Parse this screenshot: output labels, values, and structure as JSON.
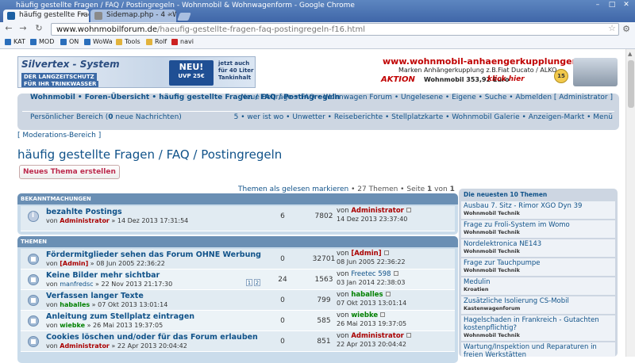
{
  "window": {
    "title": "häufig gestellte Fragen / FAQ / Postingregeln - Wohnmobil & Wohnwagenform - Google Chrome",
    "controls": [
      "–",
      "□",
      "✕"
    ]
  },
  "tabs": [
    {
      "label": "häufig gestellte Fragen",
      "active": true
    },
    {
      "label": "Sidemap.php - 4 - Wo",
      "active": false
    }
  ],
  "address": {
    "host": "www.wohnmobilforum.de",
    "path": "/haeufig-gestellte-fragen-faq-postingregeln-f16.html"
  },
  "nav_icons": {
    "back": "back-arrow-icon",
    "forward": "forward-arrow-icon",
    "reload": "reload-icon",
    "star": "bookmark-star-icon",
    "menu": "wrench-icon"
  },
  "bookmarks": [
    {
      "label": "KAT",
      "color": "#2a6ebb"
    },
    {
      "label": "MOD",
      "color": "#2a6ebb"
    },
    {
      "label": "ON",
      "color": "#2a6ebb"
    },
    {
      "label": "WoWa",
      "color": "#2a6ebb"
    },
    {
      "label": "Tools",
      "color": "#e2b33d"
    },
    {
      "label": "Rolf",
      "color": "#e2b33d"
    },
    {
      "label": "navi",
      "color": "#cc2222"
    }
  ],
  "banner_left": {
    "title": "Silvertex - System",
    "line1": "DER LANGZEITSCHUTZ",
    "line2": "FÜR IHR TRINKWASSER",
    "badge_top": "NEU!",
    "badge_sub": "UVP 25€",
    "side_text1": "jetzt auch",
    "side_text2": "für 40 Liter",
    "side_text3": "Tankinhalt"
  },
  "banner_right": {
    "url": "www.wohnmobil-anhaengerkupplungen.de",
    "line2": "Marken Anhängerkupplung z.B.Fiat Ducato / ALKO",
    "aktion": "AKTION",
    "price": "Wohnmobil 353,92 Euro",
    "cta": "klick hier",
    "badge": "15"
  },
  "navbar": {
    "breadcrumb": "Wohnmobil • Foren-Übersicht • häufig gestellte Fragen / FAQ / Postingregeln",
    "quick_links": "Neue Beiträge • FAQ • Wohnwagen Forum • Ungelesene • Eigene • Suche • Abmelden [ Administrator ]",
    "personal_prefix": "Persönlicher Bereich (",
    "personal_count": "0",
    "personal_suffix": " neue Nachrichten)",
    "links2": "5 • wer ist wo • Unwetter • Reiseberichte • Stellplatzkarte • Wohnmobil Galerie • Anzeigen-Markt • Menü"
  },
  "moderation": "[ Moderations-Bereich ]",
  "page_title": "häufig gestellte Fragen / FAQ / Postingregeln",
  "new_topic_button": "Neues Thema erstellen",
  "pagination": {
    "mark_read": "Themen als gelesen markieren",
    "count": " • 27 Themen • Seite ",
    "current": "1",
    "of": " von ",
    "total": "1"
  },
  "announcements": {
    "header": "BEKANNTMACHUNGEN",
    "topics": [
      {
        "title": "bezahlte Postings",
        "by": "von ",
        "author": "Administrator",
        "date": " » 14 Dez 2013 17:31:54",
        "replies": "6",
        "views": "7802",
        "last_by": "von ",
        "last_author": "Administrator",
        "last_date": "14 Dez 2013 23:37:40"
      }
    ]
  },
  "topics": {
    "header": "THEMEN",
    "items": [
      {
        "title": "Fördermitglieder sehen das Forum OHNE Werbung",
        "by": "von ",
        "author": "[Admin]",
        "date": " » 08 Jun 2005 22:36:22",
        "replies": "0",
        "views": "32701",
        "last_by": "von ",
        "last_author": "[Admin]",
        "last_date": "08 Jun 2005 22:36:22",
        "author_color": "red",
        "pages": []
      },
      {
        "title": "Keine Bilder mehr sichtbar",
        "by": "von ",
        "author": "manfredsc",
        "date": " » 22 Nov 2013 21:17:30",
        "replies": "24",
        "views": "1563",
        "last_by": "von ",
        "last_author": "Freetec 598",
        "last_date": "03 Jan 2014 22:38:03",
        "author_color": "blue",
        "pages": [
          "1",
          "2"
        ]
      },
      {
        "title": "Verfassen langer Texte",
        "by": "von ",
        "author": "haballes",
        "date": " » 07 Okt 2013 13:01:14",
        "replies": "0",
        "views": "799",
        "last_by": "von ",
        "last_author": "haballes",
        "last_date": "07 Okt 2013 13:01:14",
        "author_color": "green",
        "pages": []
      },
      {
        "title": "Anleitung zum Stellplatz eintragen",
        "by": "von ",
        "author": "wiebke",
        "date": " » 26 Mai 2013 19:37:05",
        "replies": "0",
        "views": "585",
        "last_by": "von ",
        "last_author": "wiebke",
        "last_date": "26 Mai 2013 19:37:05",
        "author_color": "green",
        "pages": []
      },
      {
        "title": "Cookies löschen und/oder für das Forum erlauben",
        "by": "von ",
        "author": "Administrator",
        "date": " » 22 Apr 2013 20:04:42",
        "replies": "0",
        "views": "851",
        "last_by": "von ",
        "last_author": "Administrator",
        "last_date": "22 Apr 2013 20:04:42",
        "author_color": "red",
        "pages": []
      }
    ]
  },
  "sidebar": {
    "header": "Die neuesten 10 Themen",
    "items": [
      {
        "title": "Ausbau 7. Sitz - Rimor XGO Dyn 39",
        "sub": "Wohnmobil Technik"
      },
      {
        "title": "Frage zu Froli-System im Womo",
        "sub": "Wohnmobil Technik"
      },
      {
        "title": "Nordelektronica NE143",
        "sub": "Wohnmobil Technik"
      },
      {
        "title": "Frage zur Tauchpumpe",
        "sub": "Wohnmobil Technik"
      },
      {
        "title": "Medulin",
        "sub": "Kroatien"
      },
      {
        "title": "Zusätzliche Isolierung CS-Mobil",
        "sub": "Kastenwagenforum"
      },
      {
        "title": "Hagelschaden in Frankreich - Gutachten kostenpflichtig?",
        "sub": "Wohnmobil Technik"
      },
      {
        "title": "Wartung/Inspektion und Reparaturen in freien Werkstätten",
        "sub": ""
      }
    ]
  }
}
